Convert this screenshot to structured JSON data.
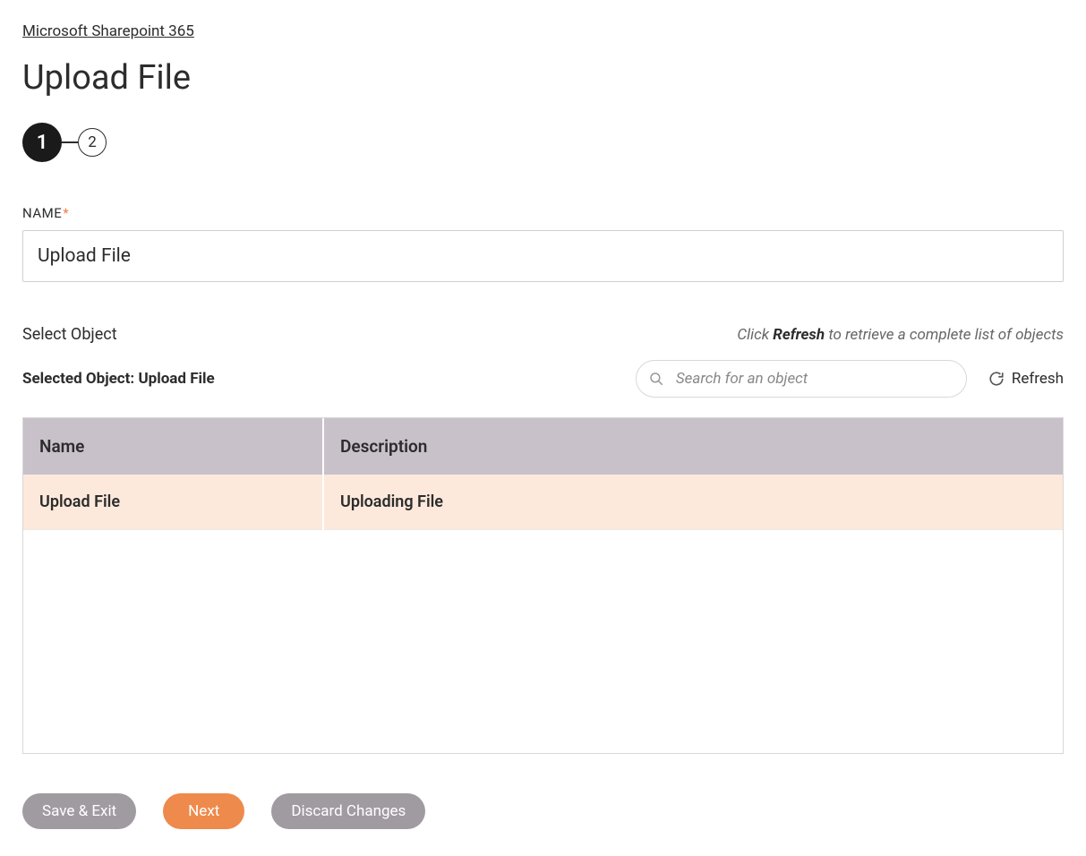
{
  "breadcrumb": "Microsoft Sharepoint 365",
  "page_title": "Upload File",
  "stepper": {
    "step1": "1",
    "step2": "2"
  },
  "name_field": {
    "label": "NAME",
    "required_mark": "*",
    "value": "Upload File"
  },
  "select_object": {
    "label": "Select Object",
    "hint_prefix": "Click ",
    "hint_bold": "Refresh",
    "hint_suffix": " to retrieve a complete list of objects",
    "selected_prefix": "Selected Object: ",
    "selected_value": "Upload File",
    "search_placeholder": "Search for an object",
    "refresh_label": "Refresh"
  },
  "table": {
    "headers": {
      "name": "Name",
      "description": "Description"
    },
    "rows": [
      {
        "name": "Upload File",
        "description": "Uploading File"
      }
    ]
  },
  "buttons": {
    "save_exit": "Save & Exit",
    "next": "Next",
    "discard": "Discard Changes"
  }
}
